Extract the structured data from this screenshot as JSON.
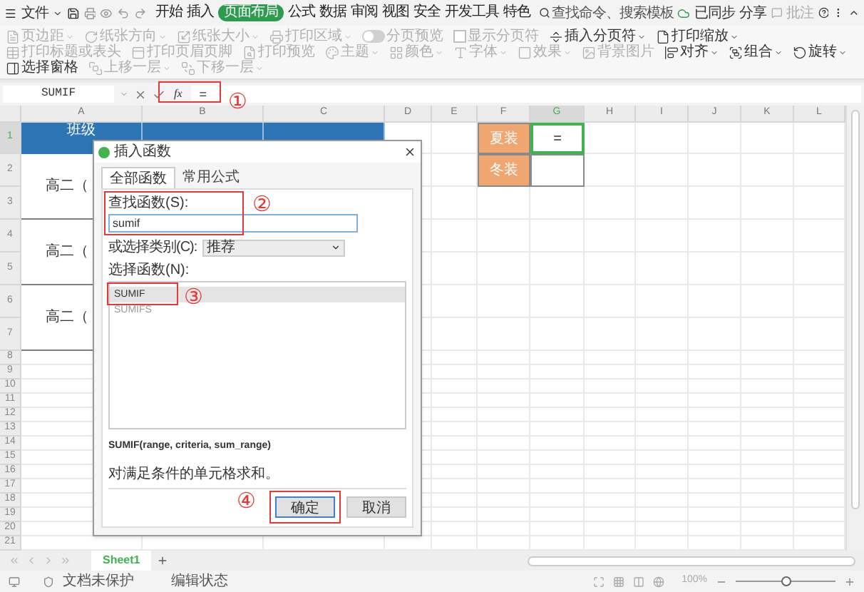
{
  "menu": {
    "label": "文件"
  },
  "ribbon_tabs": [
    {
      "label": "开始",
      "selected": false
    },
    {
      "label": "插入",
      "selected": false
    },
    {
      "label": "页面布局",
      "selected": true
    },
    {
      "label": "公式",
      "selected": false
    },
    {
      "label": "数据",
      "selected": false
    },
    {
      "label": "审阅",
      "selected": false
    },
    {
      "label": "视图",
      "selected": false
    },
    {
      "label": "安全",
      "selected": false
    },
    {
      "label": "开发工具",
      "selected": false
    },
    {
      "label": "特色",
      "selected": false
    }
  ],
  "search": {
    "placeholder": "查找命令、搜索模板"
  },
  "account": {
    "sync": "已同步",
    "share": "分享",
    "comment": "批注"
  },
  "ribbon_items": [
    {
      "label": "页边距",
      "kind": "button",
      "disabled": true,
      "dropdown": true
    },
    {
      "label": "纸张方向",
      "kind": "button",
      "disabled": true,
      "dropdown": true
    },
    {
      "label": "纸张大小",
      "kind": "button",
      "disabled": true,
      "dropdown": true
    },
    {
      "label": "打印区域",
      "kind": "button",
      "disabled": true,
      "dropdown": true
    },
    {
      "label": "分页预览",
      "kind": "toggle",
      "disabled": true,
      "on": false
    },
    {
      "label": "显示分页符",
      "kind": "checkbox",
      "disabled": true,
      "checked": false
    },
    {
      "label": "插入分页符",
      "kind": "button",
      "disabled": false,
      "dropdown": true
    },
    {
      "label": "打印缩放",
      "kind": "button",
      "disabled": false,
      "dropdown": true
    },
    {
      "label": "打印标题或表头",
      "kind": "button",
      "disabled": true
    },
    {
      "label": "打印页眉页脚",
      "kind": "button",
      "disabled": true
    },
    {
      "label": "打印预览",
      "kind": "button",
      "disabled": true
    },
    {
      "label": "主题",
      "kind": "button",
      "disabled": true,
      "dropdown": true
    },
    {
      "label": "颜色",
      "kind": "button",
      "disabled": true,
      "dropdown": true
    },
    {
      "label": "字体",
      "kind": "button",
      "disabled": true,
      "dropdown": true
    },
    {
      "label": "效果",
      "kind": "button",
      "disabled": true,
      "dropdown": true
    },
    {
      "label": "背景图片",
      "kind": "button",
      "disabled": true
    },
    {
      "label": "对齐",
      "kind": "button",
      "disabled": false,
      "dropdown": true
    },
    {
      "label": "组合",
      "kind": "button",
      "disabled": false,
      "dropdown": true
    },
    {
      "label": "旋转",
      "kind": "button",
      "disabled": false,
      "dropdown": true
    },
    {
      "label": "选择窗格",
      "kind": "button",
      "disabled": false
    },
    {
      "label": "上移一层",
      "kind": "button",
      "disabled": true,
      "dropdown": true
    },
    {
      "label": "下移一层",
      "kind": "button",
      "disabled": true,
      "dropdown": true
    }
  ],
  "formula_bar": {
    "name_box": "SUMIF",
    "fx": "fx",
    "formula": "="
  },
  "columns": [
    {
      "label": "A",
      "selected": false
    },
    {
      "label": "B",
      "selected": false
    },
    {
      "label": "C",
      "selected": false
    },
    {
      "label": "D",
      "selected": false
    },
    {
      "label": "E",
      "selected": false
    },
    {
      "label": "F",
      "selected": false
    },
    {
      "label": "G",
      "selected": true
    },
    {
      "label": "H",
      "selected": false
    },
    {
      "label": "I",
      "selected": false
    },
    {
      "label": "J",
      "selected": false
    },
    {
      "label": "K",
      "selected": false
    },
    {
      "label": "L",
      "selected": false
    }
  ],
  "rows": [
    {
      "number": "1",
      "selected": true,
      "cells": [
        {
          "kind": "header",
          "text": "班级"
        },
        {
          "kind": "header"
        },
        {
          "kind": "header"
        },
        {
          "kind": "empty"
        },
        {
          "kind": "empty"
        },
        {
          "kind": "label",
          "text": "夏装"
        },
        {
          "kind": "value",
          "text": "=",
          "selected": true
        }
      ]
    },
    {
      "number": "2",
      "selected": false,
      "cells": [
        {
          "kind": "class",
          "text": "高二（"
        },
        {
          "kind": "class"
        },
        {
          "kind": "class"
        },
        {
          "kind": "empty"
        },
        {
          "kind": "empty"
        },
        {
          "kind": "label",
          "text": "冬装"
        },
        {
          "kind": "value",
          "selected": false
        }
      ]
    },
    {
      "number": "3",
      "selected": false,
      "cells": [
        {
          "kind": "merged"
        },
        {
          "kind": "merged"
        },
        {
          "kind": "merged"
        }
      ]
    },
    {
      "number": "4",
      "selected": false,
      "cells": [
        {
          "kind": "class",
          "text": "高二（"
        },
        {
          "kind": "class"
        },
        {
          "kind": "class"
        }
      ]
    },
    {
      "number": "5",
      "selected": false,
      "cells": [
        {
          "kind": "merged"
        },
        {
          "kind": "merged"
        },
        {
          "kind": "merged"
        }
      ]
    },
    {
      "number": "6",
      "selected": false,
      "cells": [
        {
          "kind": "class",
          "text": "高二（"
        },
        {
          "kind": "class"
        },
        {
          "kind": "class"
        }
      ]
    },
    {
      "number": "7",
      "selected": false,
      "cells": [
        {
          "kind": "merged"
        },
        {
          "kind": "merged"
        },
        {
          "kind": "merged"
        }
      ]
    },
    {
      "number": "8",
      "selected": false,
      "cells": []
    },
    {
      "number": "9",
      "selected": false,
      "cells": []
    },
    {
      "number": "10",
      "selected": false,
      "cells": []
    },
    {
      "number": "11",
      "selected": false,
      "cells": []
    },
    {
      "number": "12",
      "selected": false,
      "cells": []
    },
    {
      "number": "13",
      "selected": false,
      "cells": []
    },
    {
      "number": "14",
      "selected": false,
      "cells": []
    },
    {
      "number": "15",
      "selected": false,
      "cells": []
    },
    {
      "number": "16",
      "selected": false,
      "cells": []
    },
    {
      "number": "17",
      "selected": false,
      "cells": []
    },
    {
      "number": "18",
      "selected": false,
      "cells": []
    },
    {
      "number": "19",
      "selected": false,
      "cells": []
    },
    {
      "number": "20",
      "selected": false,
      "cells": []
    },
    {
      "number": "21",
      "selected": false,
      "cells": []
    }
  ],
  "dialog": {
    "title": "插入函数",
    "tabs": [
      {
        "label": "全部函数",
        "selected": true
      },
      {
        "label": "常用公式",
        "selected": false
      }
    ],
    "search_label": "查找函数(S):",
    "search_value": "sumif",
    "category_label": "或选择类别(C):",
    "category_value": "推荐",
    "list_label": "选择函数(N):",
    "functions": [
      {
        "name": "SUMIF",
        "selected": true
      },
      {
        "name": "SUMIFS",
        "selected": false
      }
    ],
    "signature": "SUMIF(range, criteria, sum_range)",
    "description": "对满足条件的单元格求和。",
    "buttons": [
      {
        "label": "确定",
        "default": true
      },
      {
        "label": "取消",
        "default": false
      }
    ]
  },
  "annotations": [
    "①",
    "②",
    "③",
    "④"
  ],
  "sheet_tabs": [
    {
      "label": "Sheet1",
      "selected": true
    }
  ],
  "status_bar": {
    "protection": "文档未保护",
    "mode": "编辑状态",
    "zoom": "100%",
    "zoom_slider": {
      "level": 0.5
    }
  }
}
